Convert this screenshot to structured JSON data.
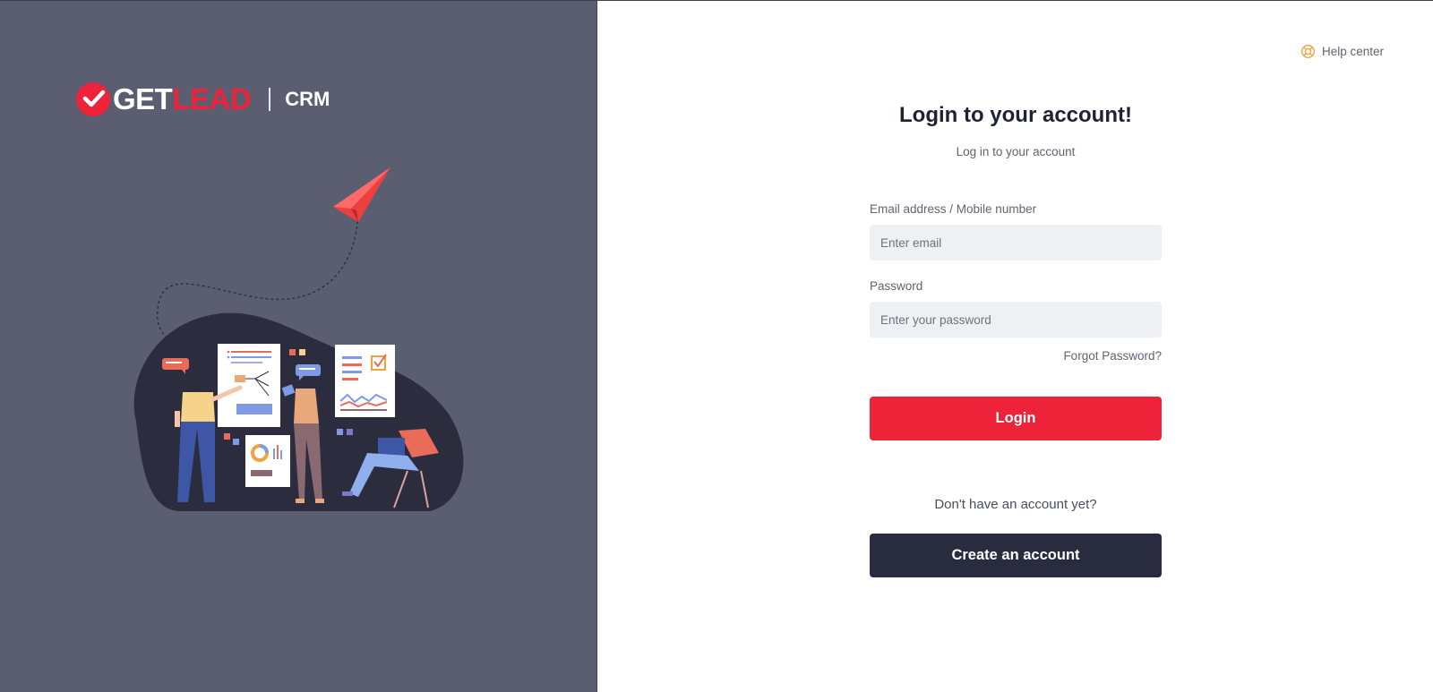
{
  "brand": {
    "word_white": "GET",
    "word_red": "LEAD",
    "product": "CRM",
    "colors": {
      "accent": "#ee2339",
      "panel": "#5b5d71",
      "dark_button": "#292b3f",
      "help_icon": "#f0a33a"
    }
  },
  "header": {
    "help_label": "Help center",
    "help_icon": "lifebuoy-icon"
  },
  "login": {
    "title": "Login to your account!",
    "subtitle": "Log in to your account",
    "email_label": "Email address / Mobile number",
    "email_placeholder": "Enter email",
    "email_value": "",
    "password_label": "Password",
    "password_placeholder": "Enter your password",
    "password_value": "",
    "forgot_label": "Forgot Password?",
    "login_button": "Login"
  },
  "signup": {
    "prompt": "Don't have an account yet?",
    "create_button": "Create an account"
  }
}
